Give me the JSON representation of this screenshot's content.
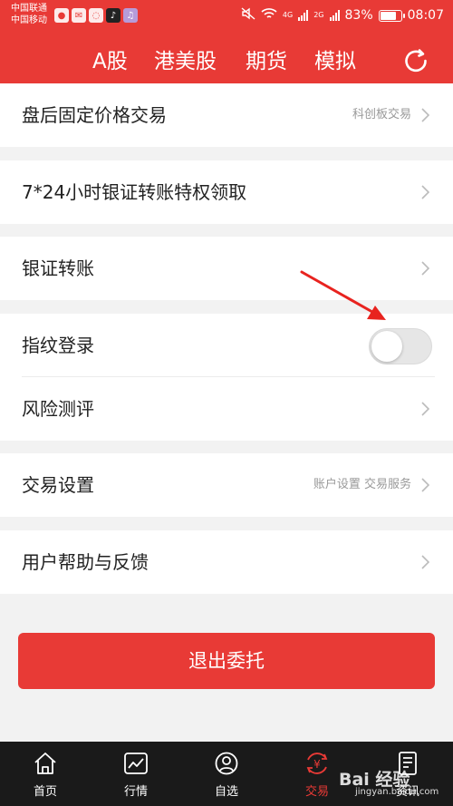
{
  "status": {
    "carrier_line1": "中国联通",
    "carrier_line2": "中国移动",
    "battery_pct": "83%",
    "battery_level": 0.83,
    "time": "08:07",
    "net1": "4G",
    "net2": "2G"
  },
  "header": {
    "tabs": [
      "A股",
      "港美股",
      "期货",
      "模拟"
    ],
    "refresh_icon": "refresh-icon"
  },
  "rows": {
    "after_hours": {
      "label": "盘后固定价格交易",
      "right": "科创板交易"
    },
    "bank_transfer_24h": {
      "label": "7*24小时银证转账特权领取"
    },
    "bank_transfer": {
      "label": "银证转账"
    },
    "fingerprint": {
      "label": "指纹登录",
      "enabled": false
    },
    "risk": {
      "label": "风险测评"
    },
    "trade_settings": {
      "label": "交易设置",
      "right": "账户设置 交易服务"
    },
    "help": {
      "label": "用户帮助与反馈"
    }
  },
  "logout": {
    "label": "退出委托"
  },
  "tabbar": {
    "items": [
      {
        "label": "首页",
        "icon": "home-icon"
      },
      {
        "label": "行情",
        "icon": "chart-icon"
      },
      {
        "label": "自选",
        "icon": "favorites-icon"
      },
      {
        "label": "交易",
        "icon": "trade-icon",
        "active": true
      },
      {
        "label": "资讯",
        "icon": "news-icon"
      }
    ]
  },
  "watermark": {
    "brand": "Bai 经验",
    "site": "jingyan.baidu.com"
  },
  "colors": {
    "accent": "#e83a36",
    "tabbar": "#1a1a1a",
    "background": "#f2f2f2"
  }
}
